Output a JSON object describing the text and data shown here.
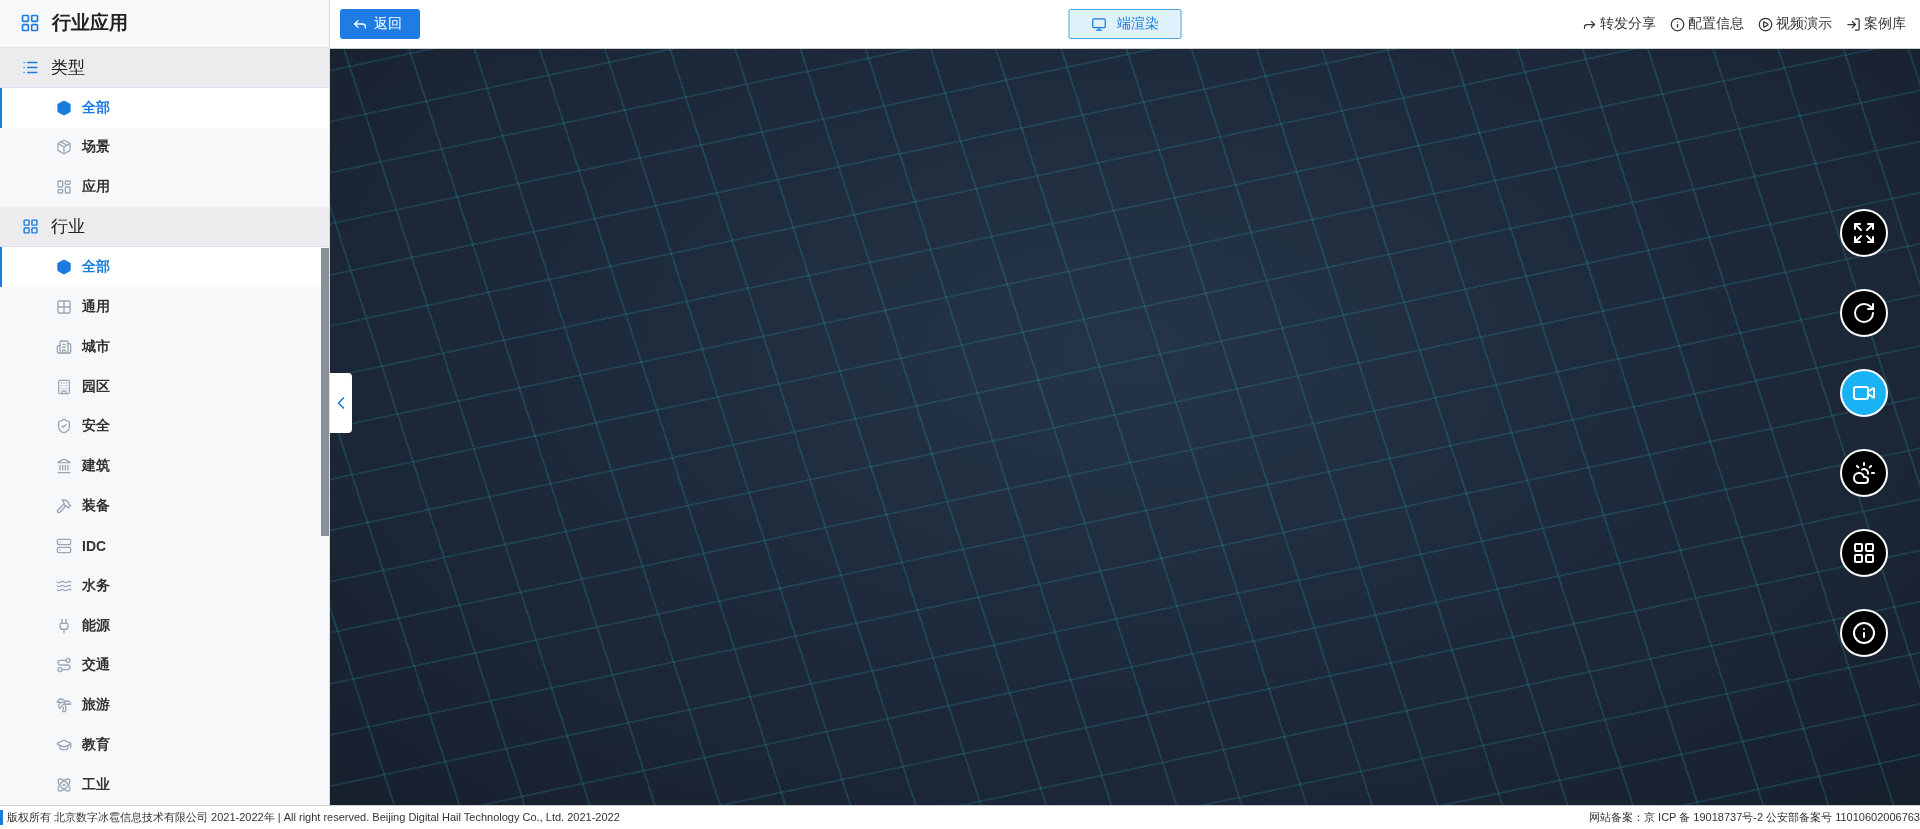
{
  "sidebar": {
    "title": "行业应用",
    "sections": [
      {
        "title": "类型",
        "items": [
          {
            "label": "全部",
            "selected": true
          },
          {
            "label": "场景",
            "selected": false
          },
          {
            "label": "应用",
            "selected": false
          }
        ]
      },
      {
        "title": "行业",
        "items": [
          {
            "label": "全部",
            "selected": true
          },
          {
            "label": "通用",
            "selected": false
          },
          {
            "label": "城市",
            "selected": false
          },
          {
            "label": "园区",
            "selected": false
          },
          {
            "label": "安全",
            "selected": false
          },
          {
            "label": "建筑",
            "selected": false
          },
          {
            "label": "装备",
            "selected": false
          },
          {
            "label": "IDC",
            "selected": false
          },
          {
            "label": "水务",
            "selected": false
          },
          {
            "label": "能源",
            "selected": false
          },
          {
            "label": "交通",
            "selected": false
          },
          {
            "label": "旅游",
            "selected": false
          },
          {
            "label": "教育",
            "selected": false
          },
          {
            "label": "工业",
            "selected": false
          }
        ]
      }
    ]
  },
  "toolbar": {
    "back": "返回",
    "render_mode": "端渲染",
    "links": [
      "转发分享",
      "配置信息",
      "视频演示",
      "案例库"
    ]
  },
  "view_tools": [
    {
      "on": false
    },
    {
      "on": false
    },
    {
      "on": true
    },
    {
      "on": false
    },
    {
      "on": false
    },
    {
      "on": false
    }
  ],
  "footer": {
    "copyright": "版权所有 北京数字冰雹信息技术有限公司 2021-2022年 | All right reserved. Beijing Digital Hail Technology Co., Ltd. 2021-2022",
    "record": "网站备案：京 ICP 备 19018737号-2 公安部备案号 11010602006763"
  }
}
